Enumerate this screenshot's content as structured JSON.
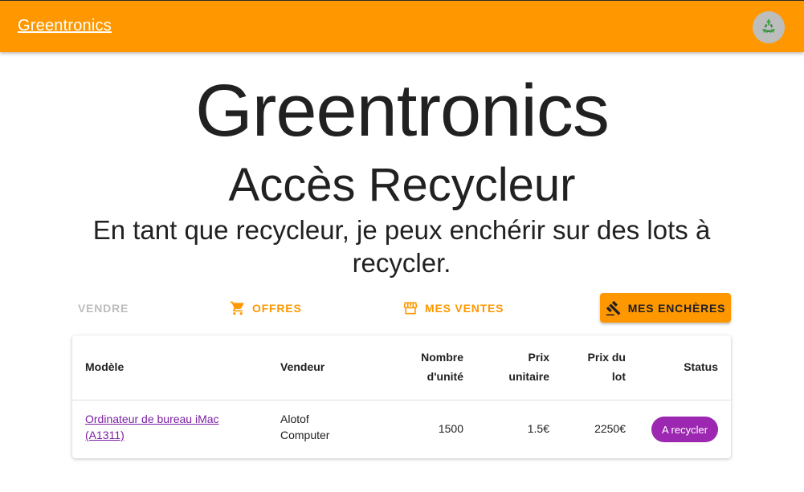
{
  "appbar": {
    "brand": "Greentronics",
    "avatar_icon": "recycle-icon"
  },
  "hero": {
    "title": "Greentronics",
    "subtitle": "Accès Recycleur",
    "description": "En tant que recycleur, je peux enchérir sur des lots à recycler."
  },
  "tabs": [
    {
      "label": "Vendre",
      "icon": "",
      "state": "disabled"
    },
    {
      "label": "Offres",
      "icon": "cart-icon",
      "state": "default"
    },
    {
      "label": "Mes ventes",
      "icon": "store-icon",
      "state": "default"
    },
    {
      "label": "Mes enchères",
      "icon": "gavel-icon",
      "state": "active"
    }
  ],
  "table": {
    "headers": {
      "model": "Modèle",
      "seller": "Vendeur",
      "units_line1": "Nombre",
      "units_line2": "d'unité",
      "unit_price_line1": "Prix",
      "unit_price_line2": "unitaire",
      "lot_price_line1": "Prix du",
      "lot_price_line2": "lot",
      "status": "Status"
    },
    "rows": [
      {
        "model_line1": "Ordinateur de bureau iMac",
        "model_line2": "(A1311)",
        "seller_line1": "Alotof",
        "seller_line2": "Computer",
        "units": "1500",
        "unit_price": "1.5€",
        "lot_price": "2250€",
        "status": "A recycler"
      }
    ]
  },
  "colors": {
    "primary": "#ff9800",
    "status_chip": "#9c27b0",
    "link": "#7b1fa2",
    "disabled": "#bdbdbd"
  }
}
